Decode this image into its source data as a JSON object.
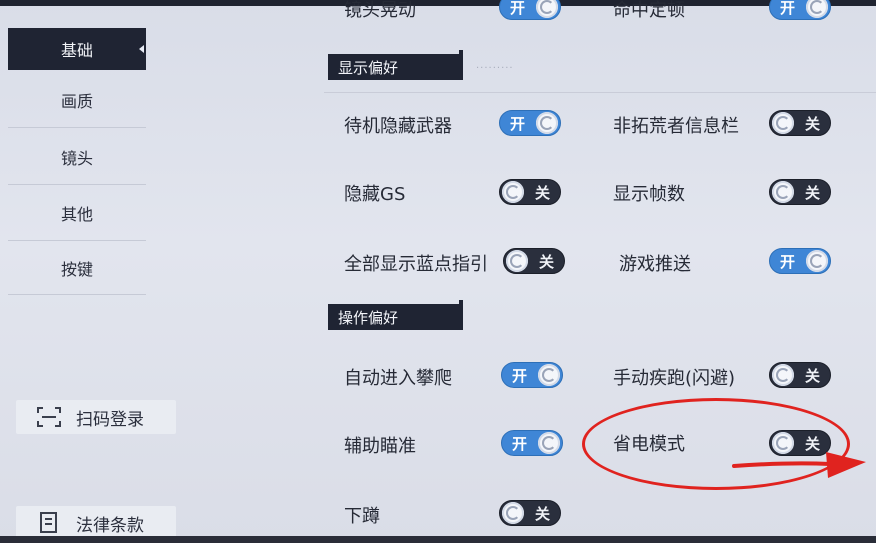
{
  "sidebar": {
    "items": [
      {
        "label": "基础",
        "active": true
      },
      {
        "label": "画质",
        "active": false
      },
      {
        "label": "镜头",
        "active": false
      },
      {
        "label": "其他",
        "active": false
      },
      {
        "label": "按键",
        "active": false
      }
    ],
    "scan_login": {
      "label": "扫码登录",
      "icon": "scan-icon"
    },
    "legal": {
      "label": "法律条款",
      "icon": "document-icon"
    }
  },
  "top_row": {
    "left": {
      "label": "镜头晃动",
      "state": "开"
    },
    "right": {
      "label": "命中定顿",
      "state": "开"
    }
  },
  "sections": {
    "display": {
      "title": "显示偏好",
      "dots": "·········",
      "items": [
        {
          "label": "待机隐藏武器",
          "state": "开"
        },
        {
          "label": "非拓荒者信息栏",
          "state": "关"
        },
        {
          "label": "隐藏GS",
          "state": "关"
        },
        {
          "label": "显示帧数",
          "state": "关"
        },
        {
          "label": "全部显示蓝点指引",
          "state": "关"
        },
        {
          "label": "游戏推送",
          "state": "开"
        }
      ]
    },
    "operation": {
      "title": "操作偏好",
      "items": [
        {
          "label": "自动进入攀爬",
          "state": "开"
        },
        {
          "label": "手动疾跑(闪避)",
          "state": "关"
        },
        {
          "label": "辅助瞄准",
          "state": "开"
        },
        {
          "label": "省电模式",
          "state": "关"
        },
        {
          "label": "下蹲",
          "state": "关"
        }
      ]
    }
  },
  "colors": {
    "toggle_on": "#3f86d6",
    "toggle_off": "#2a2f3d",
    "annotation": "#e0231f"
  }
}
